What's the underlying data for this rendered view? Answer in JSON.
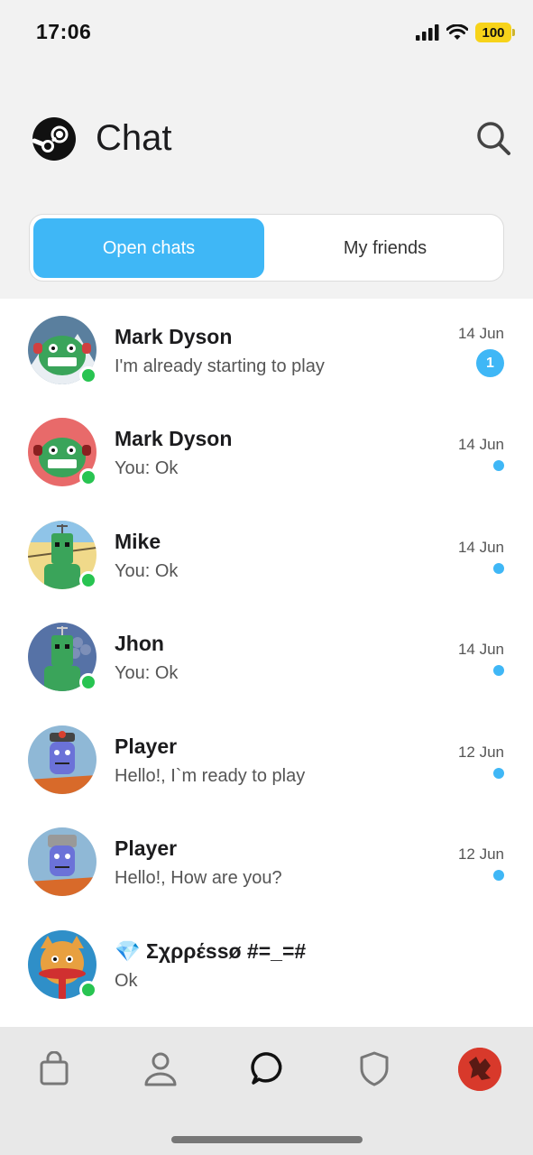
{
  "status_bar": {
    "time": "17:06",
    "battery": "100"
  },
  "header": {
    "title": "Chat",
    "logo_icon": "steam-logo",
    "search_icon": "search-icon"
  },
  "tabs": {
    "open_chats": "Open chats",
    "my_friends": "My friends",
    "active": "Open chats"
  },
  "chats": [
    {
      "name": "Mark Dyson",
      "message": "I'm already starting to play",
      "date": "14 Jun",
      "unread_count": "1",
      "online": true,
      "avatar_bg": "#5a7f9e"
    },
    {
      "name": "Mark Dyson",
      "message": "You: Ok",
      "date": "14 Jun",
      "online": true,
      "avatar_bg": "#e86a6a"
    },
    {
      "name": "Mike",
      "message": "You: Ok",
      "date": "14 Jun",
      "online": true,
      "avatar_bg": "#f0d98a"
    },
    {
      "name": "Jhon",
      "message": "You: Ok",
      "date": "14 Jun",
      "online": true,
      "avatar_bg": "#5672a6"
    },
    {
      "name": "Player",
      "message": "Hello!, I`m ready to play",
      "date": "12 Jun",
      "online": false,
      "avatar_bg": "#8fb8d6"
    },
    {
      "name": "Player",
      "message": "Hello!, How are you?",
      "date": "12 Jun",
      "online": false,
      "avatar_bg": "#8fb8d6"
    },
    {
      "name": "💎 Σχρρέssø #=_=#",
      "message": "Ok",
      "date": "",
      "online": true,
      "avatar_bg": "#2f8fc8"
    }
  ],
  "tab_bar": {
    "items": [
      "shop-bag-icon",
      "profile-icon",
      "chat-bubble-icon",
      "shield-icon",
      "user-avatar"
    ],
    "active": "chat-bubble-icon"
  },
  "colors": {
    "accent": "#3fb7f6",
    "online": "#28c451",
    "header_bg": "#f2f2f2",
    "tabbar_bg": "#e8e8e8"
  }
}
